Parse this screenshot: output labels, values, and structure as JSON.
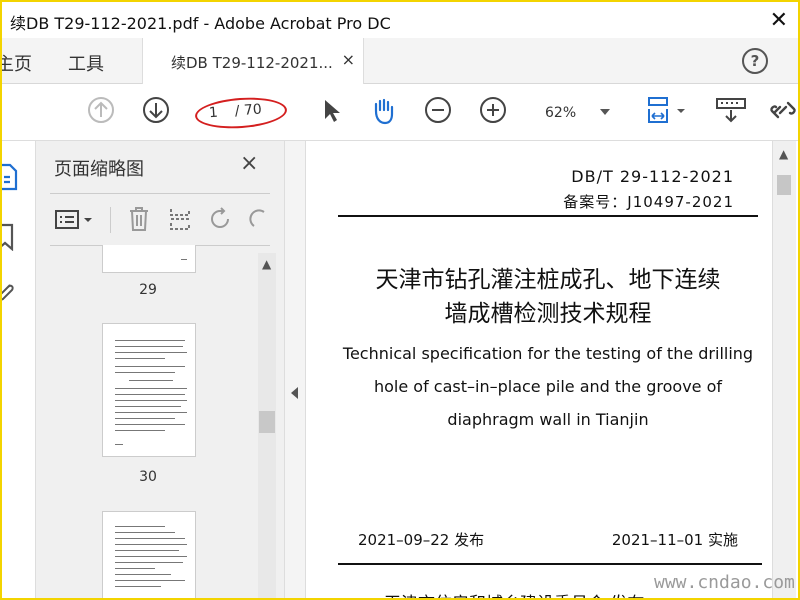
{
  "window": {
    "title": "续DB T29-112-2021.pdf - Adobe Acrobat Pro DC"
  },
  "menu": {
    "home": "主页",
    "tools": "工具"
  },
  "tab": {
    "label": "续DB T29-112-2021...",
    "close": "×"
  },
  "help": "?",
  "toolbar": {
    "current_page": "1",
    "total_pages": "/ 70",
    "zoom": "62%"
  },
  "thumbnails": {
    "title": "页面缩略图",
    "close": "×",
    "pages": [
      "29",
      "30"
    ]
  },
  "document": {
    "standard_no": "DB/T 29-112-2021",
    "record_no": "备案号：J10497-2021",
    "title_cn_line1": "天津市钻孔灌注桩成孔、地下连续",
    "title_cn_line2": "墙成槽检测技术规程",
    "title_en_line1": "Technical specification for the testing of the drilling",
    "title_en_line2": "hole of cast–in–place pile and the groove of",
    "title_en_line3": "diaphragm wall in Tianjin",
    "release_date": "2021–09–22  发布",
    "effective_date": "2021–11–01  实施",
    "issuer": "天津市住房和城乡建设委员会  发布"
  },
  "watermark": "www.cndao.com",
  "colors": {
    "accent": "#1f6fd1",
    "annotation": "#d41f1f",
    "border": "#f3d400"
  }
}
